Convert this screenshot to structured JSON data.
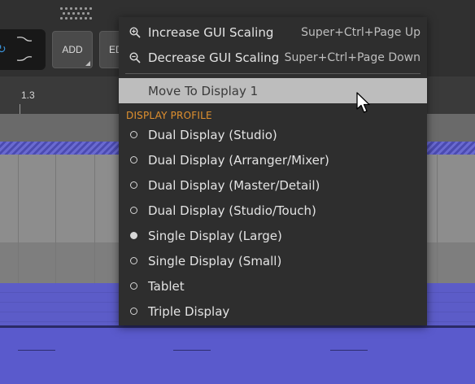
{
  "toolbar": {
    "add_label": "ADD",
    "edit_label": "ED"
  },
  "ruler": {
    "marker": "1.3"
  },
  "menu": {
    "increase_scaling": {
      "label": "Increase GUI Scaling",
      "shortcut": "Super+Ctrl+Page Up",
      "icon": "zoom-in-icon"
    },
    "decrease_scaling": {
      "label": "Decrease GUI Scaling",
      "shortcut": "Super+Ctrl+Page Down",
      "icon": "zoom-out-icon"
    },
    "move_display": {
      "label": "Move To Display 1"
    },
    "section_title": "DISPLAY PROFILE",
    "profiles": [
      {
        "label": "Dual Display (Studio)",
        "selected": false
      },
      {
        "label": "Dual Display (Arranger/Mixer)",
        "selected": false
      },
      {
        "label": "Dual Display (Master/Detail)",
        "selected": false
      },
      {
        "label": "Dual Display (Studio/Touch)",
        "selected": false
      },
      {
        "label": "Single Display (Large)",
        "selected": true
      },
      {
        "label": "Single Display (Small)",
        "selected": false
      },
      {
        "label": "Tablet",
        "selected": false
      },
      {
        "label": "Triple Display",
        "selected": false
      }
    ]
  },
  "colors": {
    "menu_bg": "#2e2e2e",
    "highlight": "#bdbdbd",
    "section_accent": "#e0902e",
    "clip_blue": "#5a5acc"
  }
}
